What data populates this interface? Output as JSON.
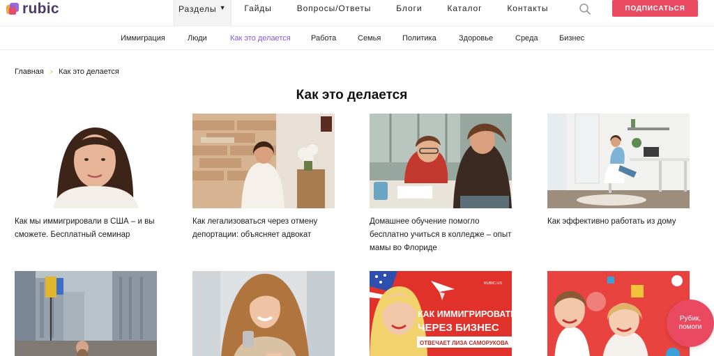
{
  "brand": {
    "logo_text": "rubic"
  },
  "mainnav": {
    "sections_label": "Разделы",
    "items": [
      "Гайды",
      "Вопросы/Ответы",
      "Блоги",
      "Каталог",
      "Контакты"
    ]
  },
  "header": {
    "subscribe_label": "ПОДПИСАТЬСЯ"
  },
  "subnav": {
    "items": [
      "Иммиграция",
      "Люди",
      "Как это делается",
      "Работа",
      "Семья",
      "Политика",
      "Здоровье",
      "Среда",
      "Бизнес"
    ],
    "active": "Как это делается"
  },
  "breadcrumb": {
    "home": "Главная",
    "separator": ">",
    "current": "Как это делается"
  },
  "page": {
    "title": "Как это делается"
  },
  "articles": [
    {
      "title": "Как мы иммигрировали в США – и вы сможете. Бесплатный семинар"
    },
    {
      "title": "Как легализоваться через отмену депортации: объясняет адвокат"
    },
    {
      "title": "Домашнее обучение помогло бесплатно учиться в колледже – опыт мамы во Флориде"
    },
    {
      "title": "Как эффективно работать из дому"
    },
    {
      "title": ""
    },
    {
      "title": ""
    },
    {
      "title": "",
      "image_text": {
        "brand": "RUBIC.US",
        "line1": "КАК ИММИГРИРОВАТЬ",
        "line2": "ЧЕРЕЗ БИЗНЕС",
        "line3": "ОТВЕЧАЕТ ЛИЗА САМОРУКОВА"
      }
    },
    {
      "title": ""
    }
  ],
  "help": {
    "line1": "Рубик,",
    "line2": "помоги"
  },
  "colors": {
    "accent": "#e94a62",
    "active_link": "#7c5cd6",
    "breadcrumb_sep": "#f2a93b"
  }
}
